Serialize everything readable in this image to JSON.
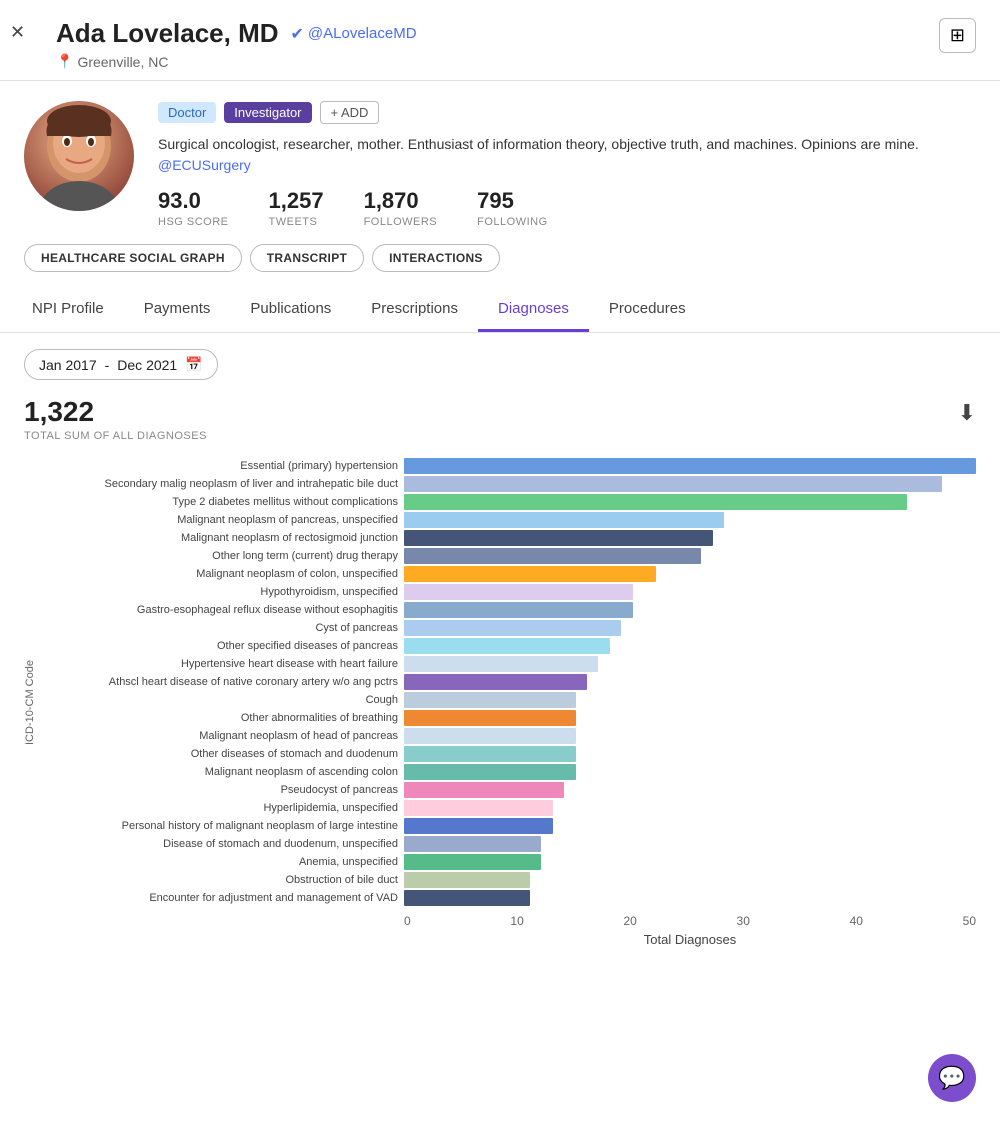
{
  "header": {
    "name": "Ada Lovelace, MD",
    "twitter_handle": "@ALovelaceMD",
    "location": "Greenville, NC",
    "grid_icon": "⊞",
    "close_icon": "✕"
  },
  "profile": {
    "badges": {
      "doctor": "Doctor",
      "investigator": "Investigator",
      "add": "+ ADD"
    },
    "bio": "Surgical oncologist, researcher, mother. Enthusiast of information theory, objective truth, and machines. Opinions are mine.",
    "bio_link": "@ECUSurgery",
    "stats": {
      "hsg_score": {
        "value": "93.0",
        "label": "HSG SCORE"
      },
      "tweets": {
        "value": "1,257",
        "label": "TWEETS"
      },
      "followers": {
        "value": "1,870",
        "label": "FOLLOWERS"
      },
      "following": {
        "value": "795",
        "label": "FOLLOWING"
      }
    }
  },
  "action_buttons": [
    "HEALTHCARE SOCIAL GRAPH",
    "TRANSCRIPT",
    "INTERACTIONS"
  ],
  "tabs": [
    {
      "label": "NPI Profile",
      "active": false
    },
    {
      "label": "Payments",
      "active": false
    },
    {
      "label": "Publications",
      "active": false
    },
    {
      "label": "Prescriptions",
      "active": false
    },
    {
      "label": "Diagnoses",
      "active": true
    },
    {
      "label": "Procedures",
      "active": false
    }
  ],
  "date_filter": {
    "start": "Jan 2017",
    "separator": " - ",
    "end": "Dec 2021"
  },
  "summary": {
    "total": "1,322",
    "label": "TOTAL SUM OF ALL DIAGNOSES"
  },
  "chart": {
    "y_axis_label": "ICD-10-CM Code",
    "x_axis_ticks": [
      "0",
      "10",
      "20",
      "30",
      "40",
      "50"
    ],
    "x_axis_label": "Total Diagnoses",
    "max_value": 50,
    "bars": [
      {
        "label": "Essential (primary) hypertension",
        "value": 50,
        "color": "#6699dd"
      },
      {
        "label": "Secondary malig neoplasm of liver and intrahepatic bile duct",
        "value": 47,
        "color": "#aabbdd"
      },
      {
        "label": "Type 2 diabetes mellitus without complications",
        "value": 44,
        "color": "#66cc88"
      },
      {
        "label": "Malignant neoplasm of pancreas, unspecified",
        "value": 28,
        "color": "#99ccee"
      },
      {
        "label": "Malignant neoplasm of rectosigmoid junction",
        "value": 27,
        "color": "#445577"
      },
      {
        "label": "Other long term (current) drug therapy",
        "value": 26,
        "color": "#7788aa"
      },
      {
        "label": "Malignant neoplasm of colon, unspecified",
        "value": 22,
        "color": "#ffaa22"
      },
      {
        "label": "Hypothyroidism, unspecified",
        "value": 20,
        "color": "#ddccee"
      },
      {
        "label": "Gastro-esophageal reflux disease without esophagitis",
        "value": 20,
        "color": "#88aacc"
      },
      {
        "label": "Cyst of pancreas",
        "value": 19,
        "color": "#aaccee"
      },
      {
        "label": "Other specified diseases of pancreas",
        "value": 18,
        "color": "#99ddee"
      },
      {
        "label": "Hypertensive heart disease with heart failure",
        "value": 17,
        "color": "#ccddee"
      },
      {
        "label": "Athscl heart disease of native coronary artery w/o ang pctrs",
        "value": 16,
        "color": "#8866bb"
      },
      {
        "label": "Cough",
        "value": 15,
        "color": "#bbccdd"
      },
      {
        "label": "Other abnormalities of breathing",
        "value": 15,
        "color": "#ee8833"
      },
      {
        "label": "Malignant neoplasm of head of pancreas",
        "value": 15,
        "color": "#ccddee"
      },
      {
        "label": "Other diseases of stomach and duodenum",
        "value": 15,
        "color": "#88cccc"
      },
      {
        "label": "Malignant neoplasm of ascending colon",
        "value": 15,
        "color": "#66bbaa"
      },
      {
        "label": "Pseudocyst of pancreas",
        "value": 14,
        "color": "#ee88bb"
      },
      {
        "label": "Hyperlipidemia, unspecified",
        "value": 13,
        "color": "#ffccdd"
      },
      {
        "label": "Personal history of malignant neoplasm of large intestine",
        "value": 13,
        "color": "#5577cc"
      },
      {
        "label": "Disease of stomach and duodenum, unspecified",
        "value": 12,
        "color": "#99aacc"
      },
      {
        "label": "Anemia, unspecified",
        "value": 12,
        "color": "#55bb88"
      },
      {
        "label": "Obstruction of bile duct",
        "value": 11,
        "color": "#bbccaa"
      },
      {
        "label": "Encounter for adjustment and management of VAD",
        "value": 11,
        "color": "#445577"
      }
    ]
  }
}
